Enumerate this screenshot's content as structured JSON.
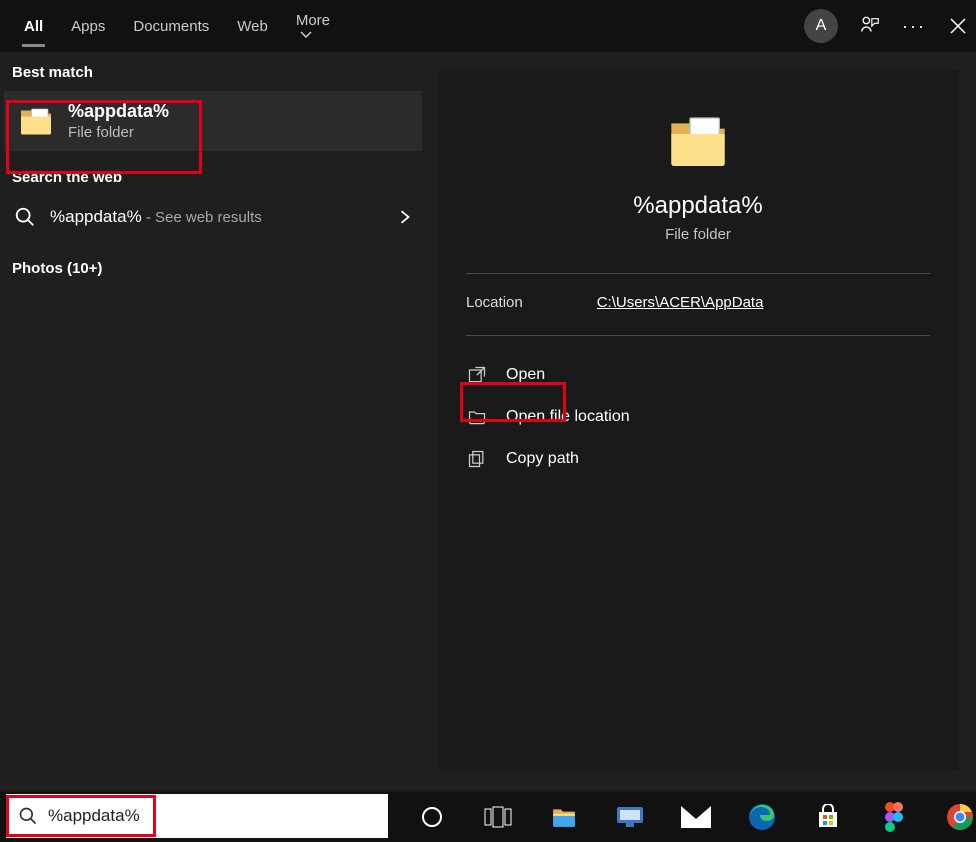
{
  "header": {
    "tabs": {
      "all": "All",
      "apps": "Apps",
      "documents": "Documents",
      "web": "Web",
      "more": "More"
    },
    "avatar_letter": "A",
    "menu_dots": "···"
  },
  "left": {
    "best_match_label": "Best match",
    "best_match": {
      "title": "%appdata%",
      "subtitle": "File folder"
    },
    "search_web_label": "Search the web",
    "web_result": {
      "query": "%appdata%",
      "suffix": " - See web results"
    },
    "photos_label": "Photos (10+)"
  },
  "preview": {
    "title": "%appdata%",
    "subtitle": "File folder",
    "location_label": "Location",
    "location_path": "C:\\Users\\ACER\\AppData",
    "actions": {
      "open": "Open",
      "open_location": "Open file location",
      "copy_path": "Copy path"
    }
  },
  "search": {
    "value": "%appdata%"
  }
}
